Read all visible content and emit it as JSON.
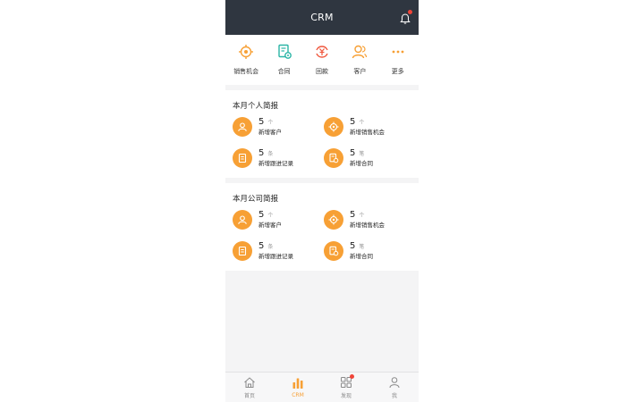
{
  "header": {
    "title": "CRM"
  },
  "quick_menu": [
    {
      "label": "销售机会",
      "icon": "target-icon",
      "color": "#f7a035"
    },
    {
      "label": "合同",
      "icon": "contract-icon",
      "color": "#2bb5a6"
    },
    {
      "label": "回款",
      "icon": "payment-icon",
      "color": "#f0573d"
    },
    {
      "label": "客户",
      "icon": "customer-icon",
      "color": "#f7a035"
    },
    {
      "label": "更多",
      "icon": "more-icon",
      "color": "#f7a035"
    }
  ],
  "personal_report": {
    "title": "本月个人简报",
    "stats": [
      {
        "value": "5",
        "unit": "个",
        "label": "新增客户"
      },
      {
        "value": "5",
        "unit": "个",
        "label": "新增销售机会"
      },
      {
        "value": "5",
        "unit": "条",
        "label": "新增跟进记录"
      },
      {
        "value": "5",
        "unit": "笔",
        "label": "新增合同"
      }
    ]
  },
  "company_report": {
    "title": "本月公司简报",
    "stats": [
      {
        "value": "5",
        "unit": "个",
        "label": "新增客户"
      },
      {
        "value": "5",
        "unit": "个",
        "label": "新增销售机会"
      },
      {
        "value": "5",
        "unit": "条",
        "label": "新增跟进记录"
      },
      {
        "value": "5",
        "unit": "笔",
        "label": "新增合同"
      }
    ]
  },
  "tabbar": [
    {
      "label": "首页",
      "icon": "home-icon",
      "active": false
    },
    {
      "label": "CRM",
      "icon": "bar-chart-icon",
      "active": true
    },
    {
      "label": "发现",
      "icon": "grid-icon",
      "active": false,
      "badge": true
    },
    {
      "label": "我",
      "icon": "user-icon",
      "active": false
    }
  ],
  "colors": {
    "header_bg": "#2f3640",
    "accent": "#f7a035",
    "badge": "#f04438"
  }
}
